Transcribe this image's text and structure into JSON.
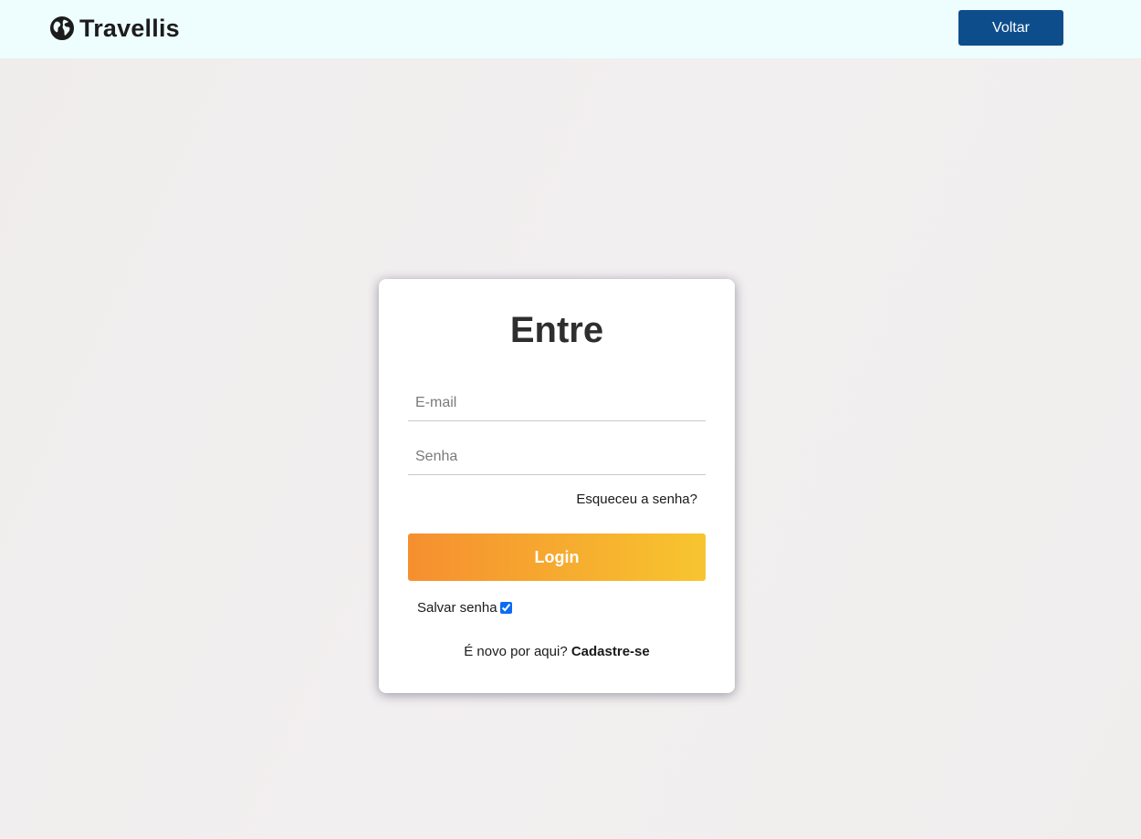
{
  "navbar": {
    "brand_name": "Travellis",
    "brand_icon": "globe-icon",
    "back_label": "Voltar",
    "back_color": "#0e4d8c",
    "background": "#eefdfd"
  },
  "login": {
    "title": "Entre",
    "email_placeholder": "E-mail",
    "email_value": "",
    "password_placeholder": "Senha",
    "password_value": "",
    "forgot_label": "Esqueceu a senha?",
    "login_label": "Login",
    "login_gradient": [
      "#f68f2f",
      "#f7c52f"
    ],
    "remember_label": "Salvar senha",
    "remember_checked": true,
    "signup_prompt": "É novo por aqui?",
    "signup_label": "Cadastre-se"
  }
}
